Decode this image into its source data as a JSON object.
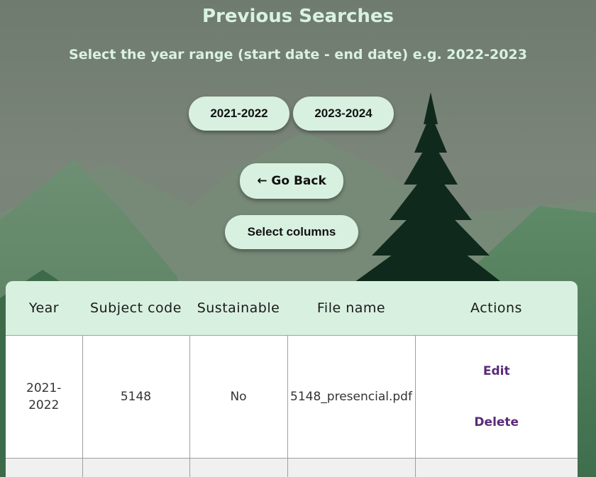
{
  "page": {
    "title": "Previous Searches",
    "subtitle": "Select the year range (start date - end date) e.g. 2022-2023"
  },
  "year_buttons": [
    "2021-2022",
    "2023-2024"
  ],
  "go_back_label": "← Go Back",
  "select_columns_label": "Select columns",
  "table": {
    "headers": [
      "Year",
      "Subject code",
      "Sustainable",
      "File name",
      "Actions"
    ],
    "rows": [
      {
        "year": "2021-2022",
        "subject_code": "5148",
        "sustainable": "No",
        "file_name": "5148_presencial.pdf",
        "edit_label": "Edit",
        "delete_label": "Delete"
      }
    ]
  },
  "colors": {
    "accent": "#d8f0e0",
    "title_text": "#d9f2e1",
    "link": "#5a2a7a",
    "tree": "#0f2a1c"
  }
}
